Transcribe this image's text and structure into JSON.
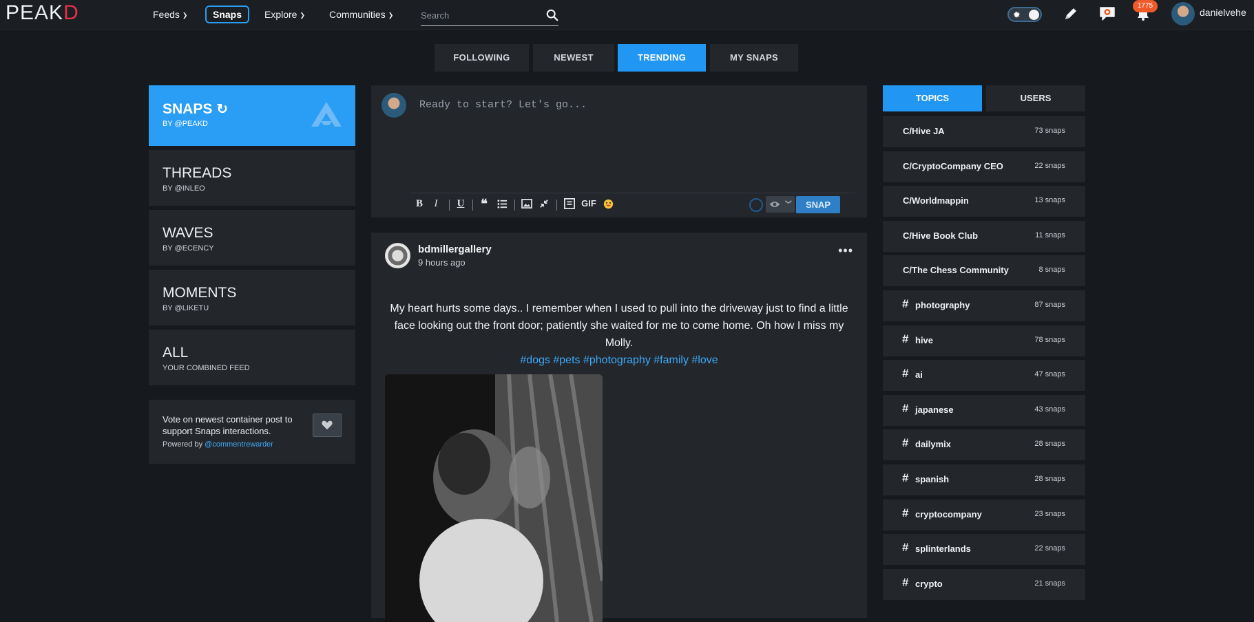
{
  "nav": {
    "logo_left": "PE",
    "logo_a": "A",
    "logo_k": "K",
    "logo_d": "D",
    "feeds": "Feeds",
    "snaps": "Snaps",
    "explore": "Explore",
    "communities": "Communities",
    "search_placeholder": "Search",
    "notification_count": "1775",
    "username": "danielvehe"
  },
  "feed_tabs": [
    {
      "label": "FOLLOWING"
    },
    {
      "label": "NEWEST"
    },
    {
      "label": "TRENDING"
    },
    {
      "label": "MY SNAPS"
    }
  ],
  "left": {
    "containers": [
      {
        "title": "SNAPS",
        "sub": "BY @PEAKD"
      },
      {
        "title": "THREADS",
        "sub": "BY @INLEO"
      },
      {
        "title": "WAVES",
        "sub": "BY @ECENCY"
      },
      {
        "title": "MOMENTS",
        "sub": "BY @LIKETU"
      },
      {
        "title": "ALL",
        "sub": "YOUR COMBINED FEED"
      }
    ],
    "vote_text": "Vote on newest container post to support Snaps interactions.",
    "powered_by": "Powered by",
    "powered_link": "@commentrewarder"
  },
  "composer": {
    "placeholder": "Ready to start? Let's go...",
    "gif_label": "GIF",
    "snap_label": "SNAP"
  },
  "post": {
    "author": "bdmillergallery",
    "time": "9 hours ago",
    "text": "My heart hurts some days.. I remember when I used to pull into the driveway just to find a little face looking out the front door; patiently she waited for me to come home. Oh how I miss my Molly.",
    "tags": [
      "#dogs",
      "#pets",
      "#photography",
      "#family",
      "#love"
    ]
  },
  "right": {
    "tabs": [
      {
        "label": "TOPICS"
      },
      {
        "label": "USERS"
      }
    ],
    "topics": [
      {
        "name": "C/Hive JA",
        "count": "73 snaps",
        "hash": false
      },
      {
        "name": "C/CryptoCompany CEO",
        "count": "22 snaps",
        "hash": false
      },
      {
        "name": "C/Worldmappin",
        "count": "13 snaps",
        "hash": false
      },
      {
        "name": "C/Hive Book Club",
        "count": "11 snaps",
        "hash": false
      },
      {
        "name": "C/The Chess Community",
        "count": "8 snaps",
        "hash": false
      },
      {
        "name": "photography",
        "count": "87 snaps",
        "hash": true
      },
      {
        "name": "hive",
        "count": "78 snaps",
        "hash": true
      },
      {
        "name": "ai",
        "count": "47 snaps",
        "hash": true
      },
      {
        "name": "japanese",
        "count": "43 snaps",
        "hash": true
      },
      {
        "name": "dailymix",
        "count": "28 snaps",
        "hash": true
      },
      {
        "name": "spanish",
        "count": "28 snaps",
        "hash": true
      },
      {
        "name": "cryptocompany",
        "count": "23 snaps",
        "hash": true
      },
      {
        "name": "splinterlands",
        "count": "22 snaps",
        "hash": true
      },
      {
        "name": "crypto",
        "count": "21 snaps",
        "hash": true
      }
    ]
  },
  "colors": {
    "accent": "#2196f3",
    "logo_d": "#e6324b",
    "badge": "#ef5a2a"
  }
}
